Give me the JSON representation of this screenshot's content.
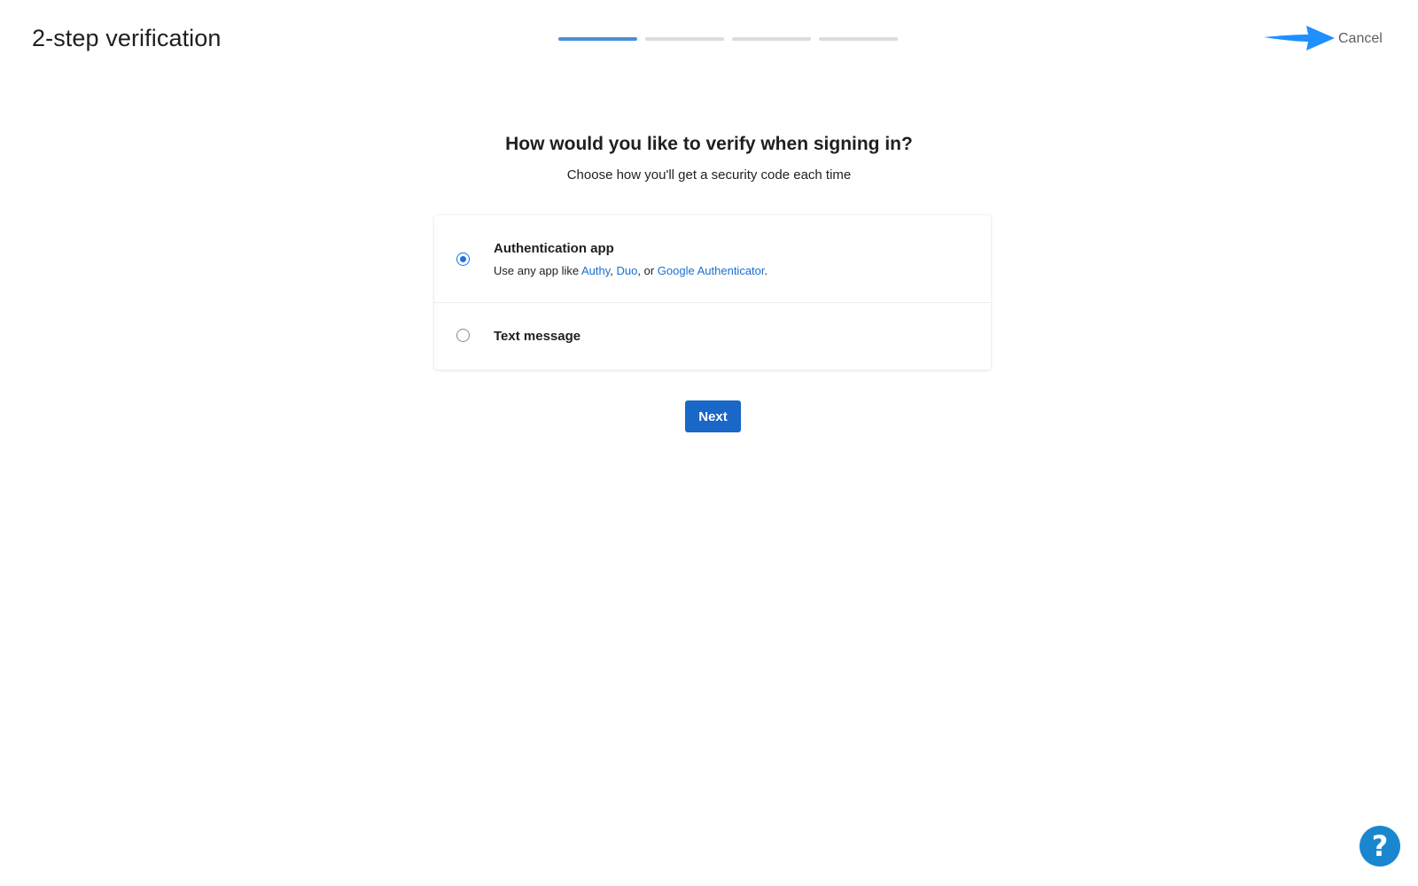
{
  "header": {
    "title": "2-step verification",
    "cancel_label": "Cancel",
    "progress": {
      "total_steps": 4,
      "current_step": 1
    }
  },
  "main": {
    "heading": "How would you like to verify when signing in?",
    "subheading": "Choose how you'll get a security code each time",
    "options": [
      {
        "label": "Authentication app",
        "selected": true,
        "description_prefix": "Use any app like ",
        "apps": [
          "Authy",
          "Duo",
          "Google Authenticator"
        ],
        "sep1": ", ",
        "sep2": ", or ",
        "description_suffix": "."
      },
      {
        "label": "Text message",
        "selected": false
      }
    ],
    "next_label": "Next"
  },
  "help": {
    "icon": "question-mark-icon",
    "glyph": "?"
  },
  "colors": {
    "accent": "#1967c6",
    "link": "#1a6fd1",
    "progress_active": "#4a90d9",
    "progress_inactive": "#dcdcdc",
    "help": "#1a86cf",
    "annotation_arrow": "#1e90ff"
  }
}
